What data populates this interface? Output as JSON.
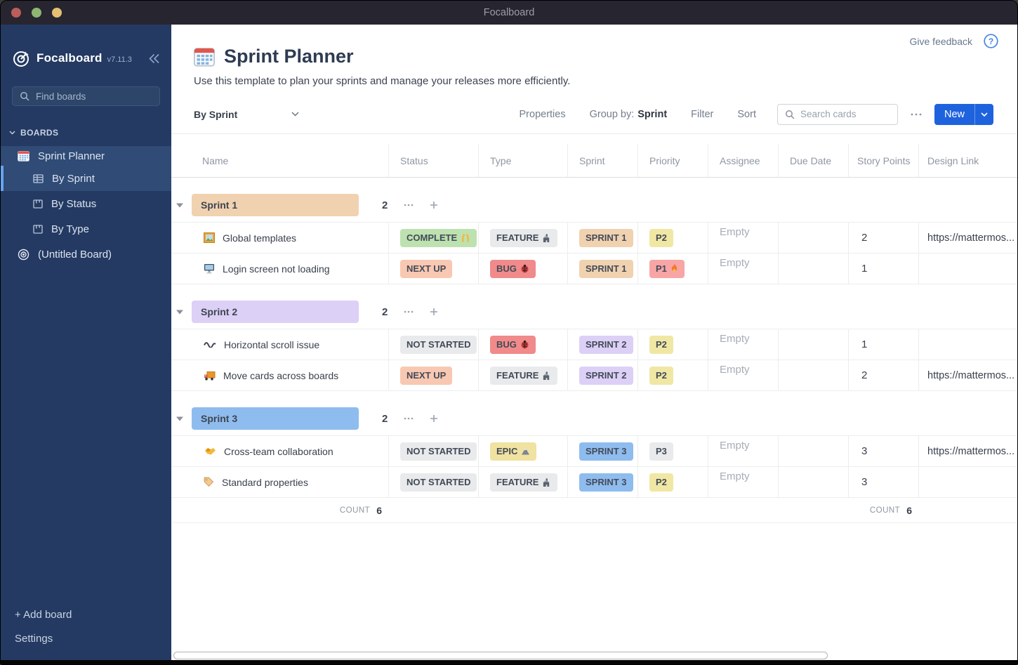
{
  "window": {
    "title": "Focalboard"
  },
  "sidebar": {
    "app_name": "Focalboard",
    "version": "v7.11.3",
    "search_placeholder": "Find boards",
    "section_label": "BOARDS",
    "board_item": {
      "label": "Sprint Planner",
      "icon": "calendar"
    },
    "views": [
      {
        "label": "By Sprint",
        "icon": "table",
        "active": true
      },
      {
        "label": "By Status",
        "icon": "board",
        "active": false
      },
      {
        "label": "By Type",
        "icon": "board",
        "active": false
      }
    ],
    "untitled_board_label": "(Untitled Board)",
    "add_board_label": "+ Add board",
    "settings_label": "Settings"
  },
  "topbar": {
    "feedback_label": "Give feedback",
    "help_icon": "question-circle"
  },
  "header": {
    "title_icon": "calendar",
    "title": "Sprint Planner",
    "description": "Use this template to plan your sprints and manage your releases more efficiently."
  },
  "toolbar": {
    "view_name": "By Sprint",
    "properties_label": "Properties",
    "group_by_label": "Group by:",
    "group_by_value": "Sprint",
    "filter_label": "Filter",
    "sort_label": "Sort",
    "search_placeholder": "Search cards",
    "new_label": "New",
    "accent_color": "#1E63DD"
  },
  "table": {
    "columns": [
      "Name",
      "Status",
      "Type",
      "Sprint",
      "Priority",
      "Assignee",
      "Due Date",
      "Story Points",
      "Design Link"
    ],
    "groups": [
      {
        "name": "Sprint 1",
        "count": "2",
        "color": "#F0D2B0",
        "rows": [
          {
            "icon": "framed-picture",
            "name": "Global templates",
            "status": {
              "label": "COMPLETE",
              "emoji": "raising-hands",
              "color": "#BEE1B0"
            },
            "type": {
              "label": "FEATURE",
              "emoji": "castle",
              "color": "#E9EAEC"
            },
            "sprint": {
              "label": "SPRINT 1",
              "color": "#F0D2B0"
            },
            "priority": {
              "label": "P2",
              "color": "#F0E7A4"
            },
            "assignee": "Empty",
            "due_date": "",
            "story_points": "2",
            "design_link": "https://mattermos..."
          },
          {
            "icon": "desktop-computer",
            "name": "Login screen not loading",
            "status": {
              "label": "NEXT UP",
              "color": "#F8C8B2"
            },
            "type": {
              "label": "BUG",
              "emoji": "ladybug",
              "color": "#F18A8A"
            },
            "sprint": {
              "label": "SPRINT 1",
              "color": "#F0D2B0"
            },
            "priority": {
              "label": "P1",
              "emoji": "fire",
              "color": "#F7A5A5"
            },
            "assignee": "Empty",
            "due_date": "",
            "story_points": "1",
            "design_link": ""
          }
        ]
      },
      {
        "name": "Sprint 2",
        "count": "2",
        "color": "#DCD0F6",
        "rows": [
          {
            "icon": "wavy-dash",
            "name": "Horizontal scroll issue",
            "status": {
              "label": "NOT STARTED",
              "suffix": ".",
              "color": "#E9EAEC"
            },
            "type": {
              "label": "BUG",
              "emoji": "ladybug",
              "color": "#F18A8A"
            },
            "sprint": {
              "label": "SPRINT 2",
              "color": "#DCD0F6"
            },
            "priority": {
              "label": "P2",
              "color": "#F0E7A4"
            },
            "assignee": "Empty",
            "due_date": "",
            "story_points": "1",
            "design_link": ""
          },
          {
            "icon": "delivery-truck",
            "name": "Move cards across boards",
            "status": {
              "label": "NEXT UP",
              "color": "#F8C8B2"
            },
            "type": {
              "label": "FEATURE",
              "emoji": "castle",
              "color": "#E9EAEC"
            },
            "sprint": {
              "label": "SPRINT 2",
              "color": "#DCD0F6"
            },
            "priority": {
              "label": "P2",
              "color": "#F0E7A4"
            },
            "assignee": "Empty",
            "due_date": "",
            "story_points": "2",
            "design_link": "https://mattermos..."
          }
        ]
      },
      {
        "name": "Sprint 3",
        "count": "2",
        "color": "#8FBCEE",
        "rows": [
          {
            "icon": "handshake",
            "name": "Cross-team collaboration",
            "status": {
              "label": "NOT STARTED",
              "suffix": ".",
              "color": "#E9EAEC"
            },
            "type": {
              "label": "EPIC",
              "emoji": "mountain",
              "color": "#F0E2A0"
            },
            "sprint": {
              "label": "SPRINT 3",
              "color": "#8FBCEE"
            },
            "priority": {
              "label": "P3",
              "color": "#E9EAEC"
            },
            "assignee": "Empty",
            "due_date": "",
            "story_points": "3",
            "design_link": "https://mattermos..."
          },
          {
            "icon": "label-tag",
            "name": "Standard properties",
            "status": {
              "label": "NOT STARTED",
              "suffix": ".",
              "color": "#E9EAEC"
            },
            "type": {
              "label": "FEATURE",
              "emoji": "castle",
              "color": "#E9EAEC"
            },
            "sprint": {
              "label": "SPRINT 3",
              "color": "#8FBCEE"
            },
            "priority": {
              "label": "P2",
              "color": "#F0E7A4"
            },
            "assignee": "Empty",
            "due_date": "",
            "story_points": "3",
            "design_link": ""
          }
        ]
      }
    ],
    "footer": {
      "count_label": "COUNT",
      "count_value": "6",
      "count_label_2": "COUNT",
      "count_value_2": "6"
    }
  }
}
